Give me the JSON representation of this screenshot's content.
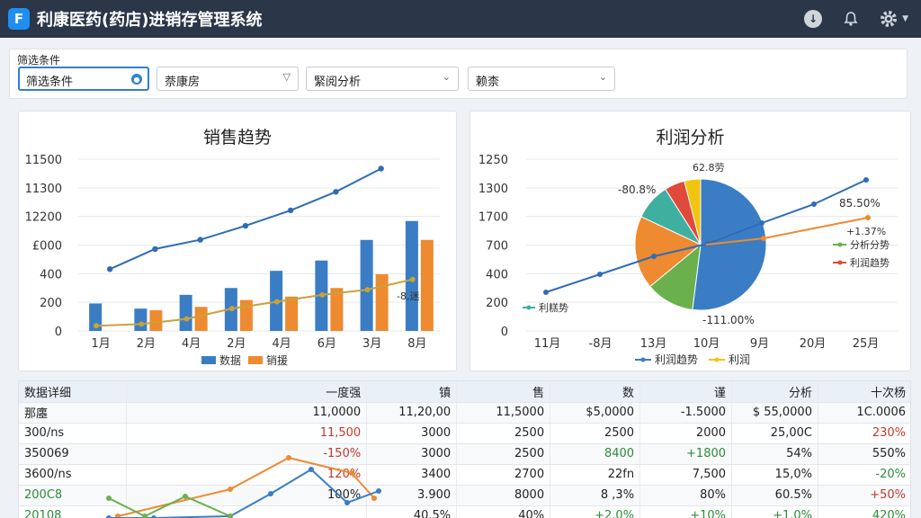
{
  "app": {
    "title": "利康医药(药店)进销存管理系统",
    "logo_letter": "F"
  },
  "header": {
    "icons": [
      "download-icon",
      "bell-icon",
      "gear-icon"
    ]
  },
  "filters": {
    "title": "筛选条件",
    "items": [
      {
        "value": "筛选条件"
      },
      {
        "value": "萘康房"
      },
      {
        "value": "緊阅分析"
      },
      {
        "value": "赖柰"
      }
    ]
  },
  "sales": {
    "title": "销售趋势",
    "chart_data": {
      "type": "bar",
      "y_ticks": [
        "11500",
        "11300",
        "12200",
        "£000",
        "400",
        "200",
        "0"
      ],
      "categories": [
        "1月",
        "2月",
        "4月",
        "2月",
        "4月",
        "6月",
        "3月",
        "8月"
      ],
      "series": [
        {
          "name": "数据",
          "color": "#3a7dc4",
          "values": [
            0.16,
            0.13,
            0.21,
            0.25,
            0.35,
            0.41,
            0.53,
            0.64
          ]
        },
        {
          "name": "销援",
          "color": "#ee8a2f",
          "values": [
            0,
            0.12,
            0.14,
            0.18,
            0.2,
            0.25,
            0.33,
            0.53
          ]
        }
      ],
      "line_top": [
        0.4,
        0.53,
        0.59,
        0.68,
        0.78,
        0.9,
        1.05
      ],
      "line_bottom": [
        0.03,
        0.04,
        0.07,
        0.13,
        0.17,
        0.21,
        0.24,
        0.3
      ],
      "annotation": "-8,迷"
    }
  },
  "profit": {
    "title": "利润分析",
    "chart_data": {
      "type": "pie",
      "y_ticks": [
        "1250",
        "1300",
        "1700",
        "700",
        "400",
        "200",
        "0"
      ],
      "x_ticks": [
        "11月",
        "-8月",
        "13月",
        "10月",
        "9月",
        "20月",
        "25月"
      ],
      "slices": [
        {
          "color": "#3a7dc4",
          "value": 0.52
        },
        {
          "color": "#6ab04c",
          "value": 0.12
        },
        {
          "color": "#ee8a2f",
          "value": 0.18
        },
        {
          "color": "#3fb0a0",
          "value": 0.09
        },
        {
          "color": "#e04a3a",
          "value": 0.05
        },
        {
          "color": "#f1c40f",
          "value": 0.04
        }
      ],
      "labels": {
        "top": "62.8劳",
        "left": "-80.8%",
        "right": "85.50%",
        "bottom": "-111.00%",
        "right2": "+1.37%"
      },
      "legend_side": [
        {
          "name": "分析分势",
          "color": "#6ab04c"
        },
        {
          "name": "利润趋势",
          "color": "#e04a3a"
        }
      ],
      "left_legend": {
        "name": "利糕势",
        "color": "#3fb0a0"
      },
      "bottom_legend": [
        {
          "name": "利润趋势",
          "color": "#3a7dc4"
        },
        {
          "name": "利润",
          "color": "#f1c40f"
        }
      ]
    }
  },
  "table": {
    "header": [
      "数据详细",
      "一度强",
      "镇",
      "售",
      "数",
      "谨",
      "分析",
      "十次杨"
    ],
    "rows": [
      {
        "cells": [
          "那廛",
          "11,0000",
          "11,20,00",
          "11,5000",
          "$5,0000",
          "-1.5000",
          "$ 55,0000",
          "1C.0006"
        ],
        "colors": [
          "",
          "",
          "",
          "",
          "",
          "",
          "",
          ""
        ]
      },
      {
        "cells": [
          "300/ns",
          "11,500",
          "3000",
          "2500",
          "2500",
          "2000",
          "25,00C",
          "230%"
        ],
        "colors": [
          "",
          "red",
          "",
          "",
          "",
          "",
          "",
          "red"
        ]
      },
      {
        "cells": [
          "350069",
          "-150%",
          "3000",
          "2500",
          "8400",
          "+1800",
          "54%",
          "550%"
        ],
        "colors": [
          "",
          "red",
          "",
          "",
          "green",
          "green",
          "",
          ""
        ]
      },
      {
        "cells": [
          "3600/ns",
          "120%",
          "3400",
          "2700",
          "22fn",
          "7,500",
          "15,0%",
          "-20%"
        ],
        "colors": [
          "",
          "red",
          "",
          "",
          "",
          "",
          "",
          "green"
        ]
      },
      {
        "cells": [
          "200C8",
          "100%",
          "3.900",
          "8000",
          "8 ,3%",
          "80%",
          "60.5%",
          "+50%"
        ],
        "colors": [
          "green",
          "",
          "",
          "",
          "",
          "",
          "",
          "red"
        ]
      },
      {
        "cells": [
          "20108",
          "",
          "40.5%",
          "40%",
          "+2.0%",
          "+10%",
          "+1.0%",
          "420%"
        ],
        "colors": [
          "green",
          "",
          "",
          "",
          "green",
          "green",
          "green",
          "green"
        ]
      }
    ]
  }
}
